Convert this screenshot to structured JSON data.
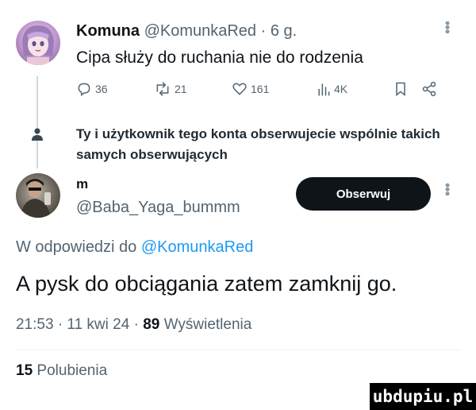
{
  "tweet": {
    "author_name": "Komuna",
    "author_handle": "@KomunkaRed",
    "time": "· 6 g.",
    "text": "Cipa służy do ruchania nie do rodzenia",
    "actions": {
      "replies": "36",
      "retweets": "21",
      "likes": "161",
      "views": "4K"
    }
  },
  "similar_followers": {
    "text": "Ty i użytkownik tego konta obserwujecie wspólnie takich samych obserwujących"
  },
  "suggested_user": {
    "name": "m",
    "handle": "@Baba_Yaga_bummm",
    "follow_label": "Obserwuj"
  },
  "reply": {
    "in_reply_prefix": "W odpowiedzi do",
    "in_reply_handle": "@KomunkaRed",
    "text": "A pysk do obciągania zatem zamknij go.",
    "meta_time": "21:53 · 11 kwi 24 · ",
    "views_count": "89",
    "views_label": "Wyświetlenia",
    "likes_count": "15",
    "likes_label": "Polubienia"
  },
  "watermark": {
    "text": "ubdupiu.pl"
  },
  "icons": {
    "reply": "reply-icon",
    "retweet": "retweet-icon",
    "like": "heart-icon",
    "views": "bar-chart-icon",
    "bookmark": "bookmark-icon",
    "share": "share-icon",
    "more": "more-vertical-icon",
    "person": "person-icon"
  },
  "colors": {
    "link": "#1d9bf0",
    "secondary_text": "#536471",
    "primary_text": "#0f1419",
    "follow_button": "#0f1419"
  }
}
